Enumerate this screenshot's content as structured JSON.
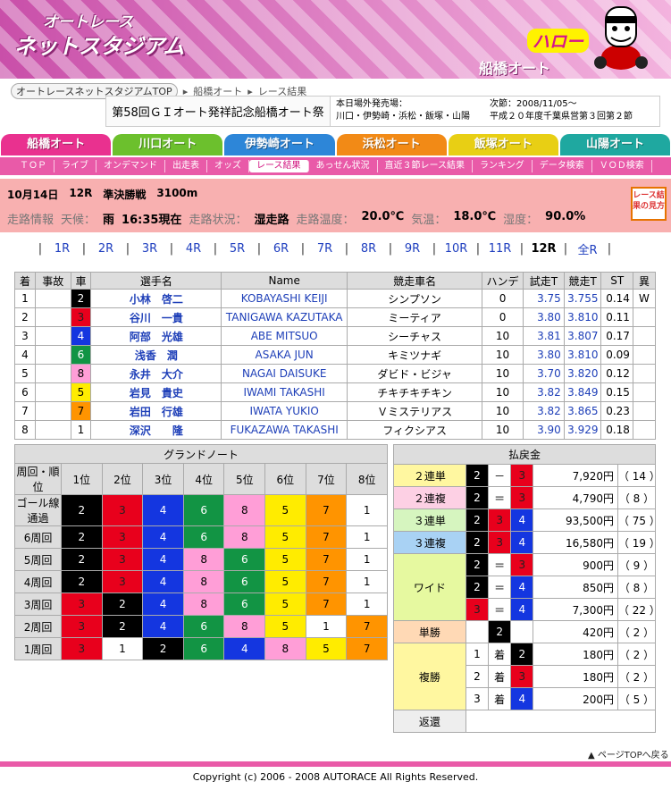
{
  "header": {
    "logo_line1": "オートレース",
    "logo_line2": "ネットスタジアム",
    "hello": "ハロー",
    "venue": "船橋オート"
  },
  "breadcrumb": {
    "home": "オートレースネットスタジアムTOP",
    "venue": "船橋オート",
    "page": "レース結果"
  },
  "event": {
    "title": "第58回ＧＩオート発祥記念船橋オート祭",
    "sales_label": "本日場外発売場：",
    "sales_venues": "川口・伊勢崎・浜松・飯塚・山陽",
    "next_label": "次節：2008/11/05～",
    "next_detail": "平成２０年度千葉県営第３回第２節"
  },
  "venue_tabs": [
    {
      "label": "船橋オート",
      "color": "#e9318f"
    },
    {
      "label": "川口オート",
      "color": "#6cc02d"
    },
    {
      "label": "伊勢崎オート",
      "color": "#2d86d8"
    },
    {
      "label": "浜松オート",
      "color": "#f28a16"
    },
    {
      "label": "飯塚オート",
      "color": "#e8cf14"
    },
    {
      "label": "山陽オート",
      "color": "#1fa8a0"
    }
  ],
  "subnav": [
    "ＴＯＰ",
    "ライブ",
    "オンデマンド",
    "出走表",
    "オッズ",
    "レース結果",
    "あっせん状況",
    "直近３節レース結果",
    "ランキング",
    "データ検索",
    "ＶＯＤ検索"
  ],
  "race": {
    "date": "10月14日",
    "race_no": "12R",
    "class": "準決勝戦",
    "distance": "3100m"
  },
  "conditions": [
    {
      "label": "走路情報",
      "value": ""
    },
    {
      "label": "天候：",
      "value": "雨"
    },
    {
      "label": "",
      "value": "16:35現在"
    },
    {
      "label": "走路状況：",
      "value": "湿走路"
    },
    {
      "label": "走路温度：",
      "value": "20.0℃"
    },
    {
      "label": "気温：",
      "value": "18.0℃"
    },
    {
      "label": "湿度：",
      "value": "90.0%"
    }
  ],
  "howto": "レース結果の見方",
  "race_nav": [
    "1R",
    "2R",
    "3R",
    "4R",
    "5R",
    "6R",
    "7R",
    "8R",
    "9R",
    "10R",
    "11R",
    "12R",
    "全R"
  ],
  "results": {
    "headers": [
      "着",
      "事故",
      "車",
      "選手名",
      "Name",
      "競走車名",
      "ハンデ",
      "試走T",
      "競走T",
      "ST",
      "異"
    ],
    "rows": [
      {
        "pos": "1",
        "acc": "",
        "car": "2",
        "name": "小林　啓二",
        "en": "KOBAYASHI KEIJI",
        "bike": "シンプソン",
        "handi": "0",
        "trial": "3.75",
        "race": "3.755",
        "st": "0.14",
        "note": "W"
      },
      {
        "pos": "2",
        "acc": "",
        "car": "3",
        "name": "谷川　一貴",
        "en": "TANIGAWA KAZUTAKA",
        "bike": "ミーティア",
        "handi": "0",
        "trial": "3.80",
        "race": "3.810",
        "st": "0.11",
        "note": ""
      },
      {
        "pos": "3",
        "acc": "",
        "car": "4",
        "name": "阿部　光雄",
        "en": "ABE MITSUO",
        "bike": "シーチャス",
        "handi": "10",
        "trial": "3.81",
        "race": "3.807",
        "st": "0.17",
        "note": ""
      },
      {
        "pos": "4",
        "acc": "",
        "car": "6",
        "name": "浅香　潤",
        "en": "ASAKA JUN",
        "bike": "キミツナギ",
        "handi": "10",
        "trial": "3.80",
        "race": "3.810",
        "st": "0.09",
        "note": ""
      },
      {
        "pos": "5",
        "acc": "",
        "car": "8",
        "name": "永井　大介",
        "en": "NAGAI DAISUKE",
        "bike": "ダビド・ビジャ",
        "handi": "10",
        "trial": "3.70",
        "race": "3.820",
        "st": "0.12",
        "note": ""
      },
      {
        "pos": "6",
        "acc": "",
        "car": "5",
        "name": "岩見　貴史",
        "en": "IWAMI TAKASHI",
        "bike": "チキチキチキン",
        "handi": "10",
        "trial": "3.82",
        "race": "3.849",
        "st": "0.15",
        "note": ""
      },
      {
        "pos": "7",
        "acc": "",
        "car": "7",
        "name": "岩田　行雄",
        "en": "IWATA YUKIO",
        "bike": "Ｖミステリアス",
        "handi": "10",
        "trial": "3.82",
        "race": "3.865",
        "st": "0.23",
        "note": ""
      },
      {
        "pos": "8",
        "acc": "",
        "car": "1",
        "name": "深沢　　隆",
        "en": "FUKAZAWA TAKASHI",
        "bike": "フィクシアス",
        "handi": "10",
        "trial": "3.90",
        "race": "3.929",
        "st": "0.18",
        "note": ""
      }
    ]
  },
  "grand_note": {
    "title": "グランドノート",
    "corner_label": "周回・順位",
    "positions": [
      "1位",
      "2位",
      "3位",
      "4位",
      "5位",
      "6位",
      "7位",
      "8位"
    ],
    "rows": [
      {
        "lap": "ゴール線通過",
        "cars": [
          "2",
          "3",
          "4",
          "6",
          "8",
          "5",
          "7",
          "1"
        ]
      },
      {
        "lap": "6周回",
        "cars": [
          "2",
          "3",
          "4",
          "6",
          "8",
          "5",
          "7",
          "1"
        ]
      },
      {
        "lap": "5周回",
        "cars": [
          "2",
          "3",
          "4",
          "8",
          "6",
          "5",
          "7",
          "1"
        ]
      },
      {
        "lap": "4周回",
        "cars": [
          "2",
          "3",
          "4",
          "8",
          "6",
          "5",
          "7",
          "1"
        ]
      },
      {
        "lap": "3周回",
        "cars": [
          "3",
          "2",
          "4",
          "8",
          "6",
          "5",
          "7",
          "1"
        ]
      },
      {
        "lap": "2周回",
        "cars": [
          "3",
          "2",
          "4",
          "6",
          "8",
          "5",
          "1",
          "7"
        ]
      },
      {
        "lap": "1周回",
        "cars": [
          "3",
          "1",
          "2",
          "6",
          "4",
          "8",
          "5",
          "7"
        ]
      }
    ]
  },
  "payout": {
    "title": "払戻金",
    "exacta": {
      "label": "２連単",
      "c1": "2",
      "sep": "－",
      "c2": "3",
      "amount": "7,920円",
      "pop": "（ 14 ）"
    },
    "quinella": {
      "label": "２連複",
      "c1": "2",
      "sep": "＝",
      "c2": "3",
      "amount": "4,790円",
      "pop": "（ 8 ）"
    },
    "trifecta": {
      "label": "３連単",
      "c1": "2",
      "c2": "3",
      "c3": "4",
      "amount": "93,500円",
      "pop": "（ 75 ）"
    },
    "trio": {
      "label": "３連複",
      "c1": "2",
      "c2": "3",
      "c3": "4",
      "amount": "16,580円",
      "pop": "（ 19 ）"
    },
    "wide": {
      "label": "ワイド",
      "rows": [
        {
          "c1": "2",
          "sep": "＝",
          "c2": "3",
          "amount": "900円",
          "pop": "（ 9 ）"
        },
        {
          "c1": "2",
          "sep": "＝",
          "c2": "4",
          "amount": "850円",
          "pop": "（ 8 ）"
        },
        {
          "c1": "3",
          "sep": "＝",
          "c2": "4",
          "amount": "7,300円",
          "pop": "（ 22 ）"
        }
      ]
    },
    "win": {
      "label": "単勝",
      "car": "2",
      "amount": "420円",
      "pop": "（ 2 ）"
    },
    "place": {
      "label": "複勝",
      "rows": [
        {
          "rank": "1",
          "unit": "着",
          "car": "2",
          "amount": "180円",
          "pop": "（ 2 ）"
        },
        {
          "rank": "2",
          "unit": "着",
          "car": "3",
          "amount": "180円",
          "pop": "（ 2 ）"
        },
        {
          "rank": "3",
          "unit": "着",
          "car": "4",
          "amount": "200円",
          "pop": "（ 5 ）"
        }
      ]
    },
    "refund": {
      "label": "返還"
    }
  },
  "footer": {
    "pagetop": "ページTOPへ戻る",
    "copyright": "Copyright (c) 2006 - 2008 AUTORACE All Rights Reserved."
  }
}
